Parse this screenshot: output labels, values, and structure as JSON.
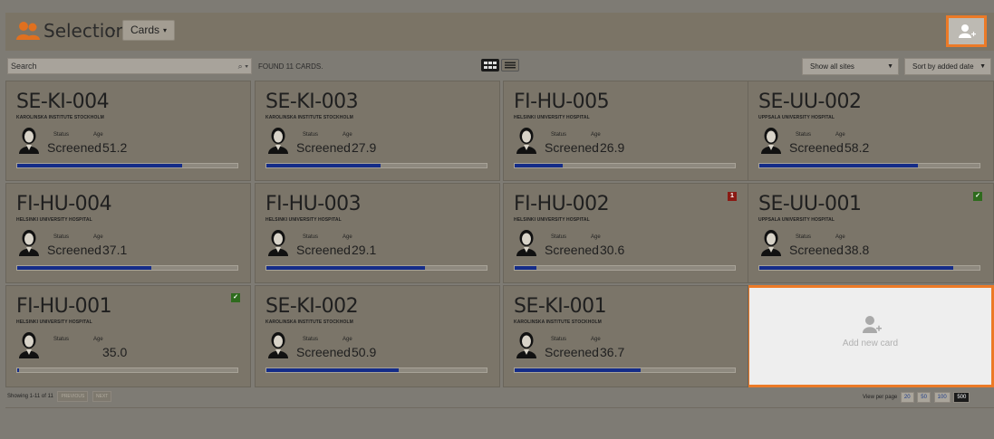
{
  "header": {
    "title": "Selection",
    "separator": "·",
    "view_label": "Cards",
    "view_caret": "▾"
  },
  "toolbar": {
    "search_placeholder": "Search",
    "search_tools": "⌕ ▾",
    "found_text": "FOUND 11 CARDS.",
    "sites_select": "Show all sites",
    "sort_select": "Sort by added date",
    "select_caret": "▼"
  },
  "colors": {
    "accent_orange": "#ec7a27",
    "progress_blue": "#142c88",
    "flag_red": "#8a1a14",
    "flag_green": "#2f6b1e"
  },
  "cards": [
    {
      "id": "SE-KI-004",
      "site": "KAROLINSKA INSTITUTE STOCKHOLM",
      "status_label": "Status",
      "age_label": "Age",
      "status": "Screened",
      "age": "51.2",
      "progress": 0.75
    },
    {
      "id": "SE-KI-003",
      "site": "KAROLINSKA INSTITUTE STOCKHOLM",
      "status_label": "Status",
      "age_label": "Age",
      "status": "Screened",
      "age": "27.9",
      "progress": 0.52
    },
    {
      "id": "FI-HU-005",
      "site": "HELSINKI UNIVERSITY HOSPITAL",
      "status_label": "Status",
      "age_label": "Age",
      "status": "Screened",
      "age": "26.9",
      "progress": 0.22
    },
    {
      "id": "SE-UU-002",
      "site": "UPPSALA UNIVERSITY HOSPITAL",
      "status_label": "Status",
      "age_label": "Age",
      "status": "Screened",
      "age": "58.2",
      "progress": 0.72
    },
    {
      "id": "FI-HU-004",
      "site": "HELSINKI UNIVERSITY HOSPITAL",
      "status_label": "Status",
      "age_label": "Age",
      "status": "Screened",
      "age": "37.1",
      "progress": 0.61
    },
    {
      "id": "FI-HU-003",
      "site": "HELSINKI UNIVERSITY HOSPITAL",
      "status_label": "Status",
      "age_label": "Age",
      "status": "Screened",
      "age": "29.1",
      "progress": 0.72
    },
    {
      "id": "FI-HU-002",
      "site": "HELSINKI UNIVERSITY HOSPITAL",
      "status_label": "Status",
      "age_label": "Age",
      "status": "Screened",
      "age": "30.6",
      "progress": 0.1,
      "flag": {
        "type": "red",
        "text": "1"
      }
    },
    {
      "id": "SE-UU-001",
      "site": "UPPSALA UNIVERSITY HOSPITAL",
      "status_label": "Status",
      "age_label": "Age",
      "status": "Screened",
      "age": "38.8",
      "progress": 0.88,
      "flag": {
        "type": "green",
        "text": "✓"
      }
    },
    {
      "id": "FI-HU-001",
      "site": "HELSINKI UNIVERSITY HOSPITAL",
      "status_label": "Status",
      "age_label": "Age",
      "status": "",
      "age": "35.0",
      "progress": 0.01,
      "flag": {
        "type": "green",
        "text": "✓"
      }
    },
    {
      "id": "SE-KI-002",
      "site": "KAROLINSKA INSTITUTE STOCKHOLM",
      "status_label": "Status",
      "age_label": "Age",
      "status": "Screened",
      "age": "50.9",
      "progress": 0.6
    },
    {
      "id": "SE-KI-001",
      "site": "KAROLINSKA INSTITUTE STOCKHOLM",
      "status_label": "Status",
      "age_label": "Age",
      "status": "Screened",
      "age": "36.7",
      "progress": 0.57
    }
  ],
  "add_card": {
    "label": "Add new card"
  },
  "pagination": {
    "showing": "Showing 1-11 of 11",
    "previous": "PREVIOUS",
    "next": "NEXT",
    "per_page_label": "View per page",
    "per_page_options": [
      "20",
      "50",
      "100",
      "500"
    ],
    "per_page_selected": "500"
  }
}
